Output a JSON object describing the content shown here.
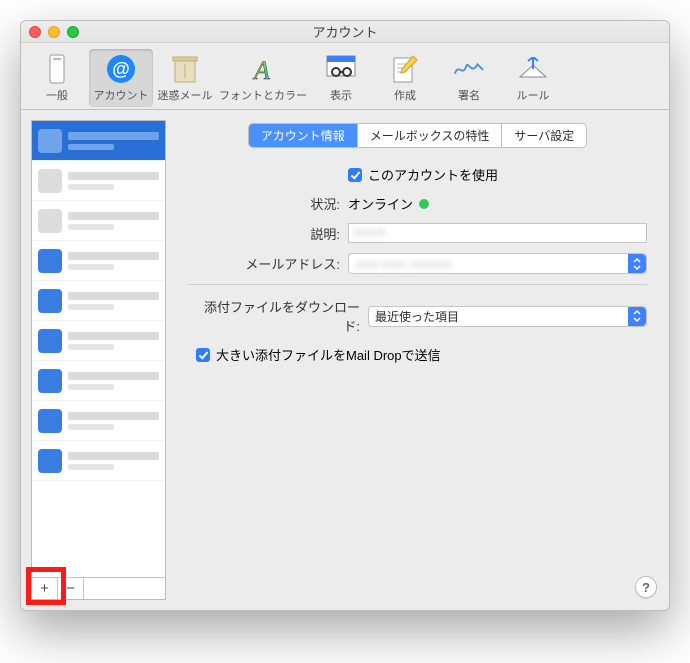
{
  "window": {
    "title": "アカウント"
  },
  "toolbar": {
    "general": "一般",
    "accounts": "アカウント",
    "junk": "迷惑メール",
    "fonts": "フォントとカラー",
    "viewing": "表示",
    "composing": "作成",
    "signatures": "署名",
    "rules": "ルール"
  },
  "sidebar": {
    "add": "+",
    "remove": "−"
  },
  "tabs": {
    "info": "アカウント情報",
    "mailbox": "メールボックスの特性",
    "server": "サーバ設定"
  },
  "form": {
    "enable_label": "このアカウントを使用",
    "status_label": "状況:",
    "status_value": "オンライン",
    "description_label": "説明:",
    "email_label": "メールアドレス:",
    "download_label": "添付ファイルをダウンロード:",
    "download_value": "最近使った項目",
    "maildrop_label": "大きい添付ファイルをMail Dropで送信"
  },
  "help": "?"
}
